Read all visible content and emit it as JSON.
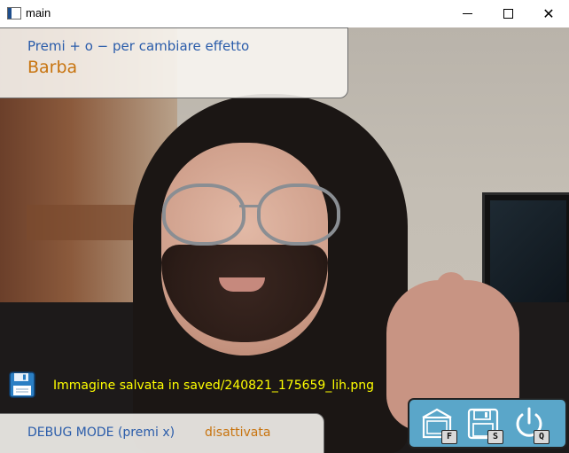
{
  "window": {
    "title": "main",
    "minimize_glyph": "—",
    "maximize_glyph": "□",
    "close_glyph": "✕"
  },
  "effect_panel": {
    "hint": "Premi + o − per cambiare effetto",
    "current_effect": "Barba"
  },
  "save_notice": {
    "icon": "floppy-disk-icon",
    "message": "Immagine salvata in saved/240821_175659_lih.png"
  },
  "debug_panel": {
    "label": "DEBUG MODE (premi x)",
    "state": "disattivata"
  },
  "controls": [
    {
      "icon": "gallery-icon",
      "key": "F"
    },
    {
      "icon": "save-icon",
      "key": "S"
    },
    {
      "icon": "power-icon",
      "key": "Q"
    }
  ],
  "colors": {
    "hint_text": "#2a5caa",
    "accent_text": "#c8740f",
    "save_message": "#ffff00",
    "controls_bg": "#5aa6c9"
  }
}
